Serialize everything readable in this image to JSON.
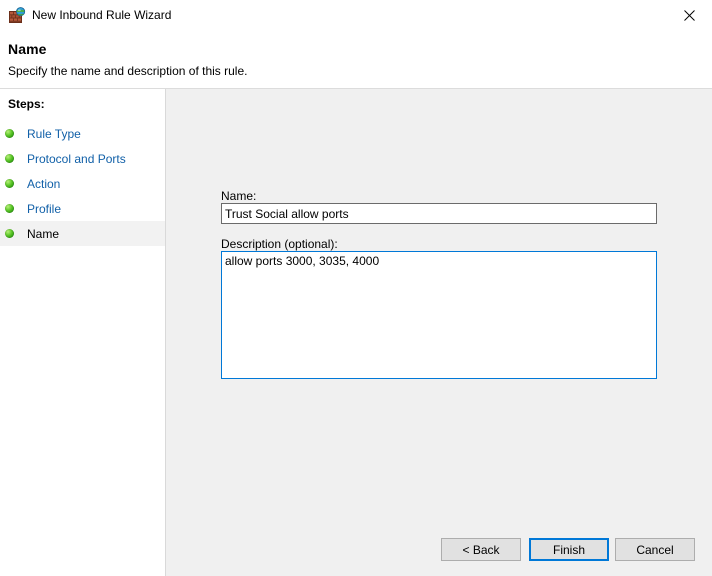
{
  "window": {
    "title": "New Inbound Rule Wizard",
    "icon": "firewall-icon",
    "close_label": "✕"
  },
  "header": {
    "title": "Name",
    "subtitle": "Specify the name and description of this rule."
  },
  "steps": {
    "header": "Steps:",
    "items": [
      {
        "label": "Rule Type",
        "current": false
      },
      {
        "label": "Protocol and Ports",
        "current": false
      },
      {
        "label": "Action",
        "current": false
      },
      {
        "label": "Profile",
        "current": false
      },
      {
        "label": "Name",
        "current": true
      }
    ]
  },
  "form": {
    "name_label": "Name:",
    "name_value": "Trust Social allow ports",
    "name_placeholder": "",
    "description_label": "Description (optional):",
    "description_value": "allow ports 3000, 3035, 4000",
    "description_placeholder": ""
  },
  "buttons": {
    "back": "< Back",
    "finish": "Finish",
    "cancel": "Cancel"
  },
  "colors": {
    "accent": "#0078d7",
    "link": "#1160a8",
    "panel": "#f0f0f0",
    "button_face": "#e1e1e1",
    "bullet_green": "#5ec82a"
  }
}
